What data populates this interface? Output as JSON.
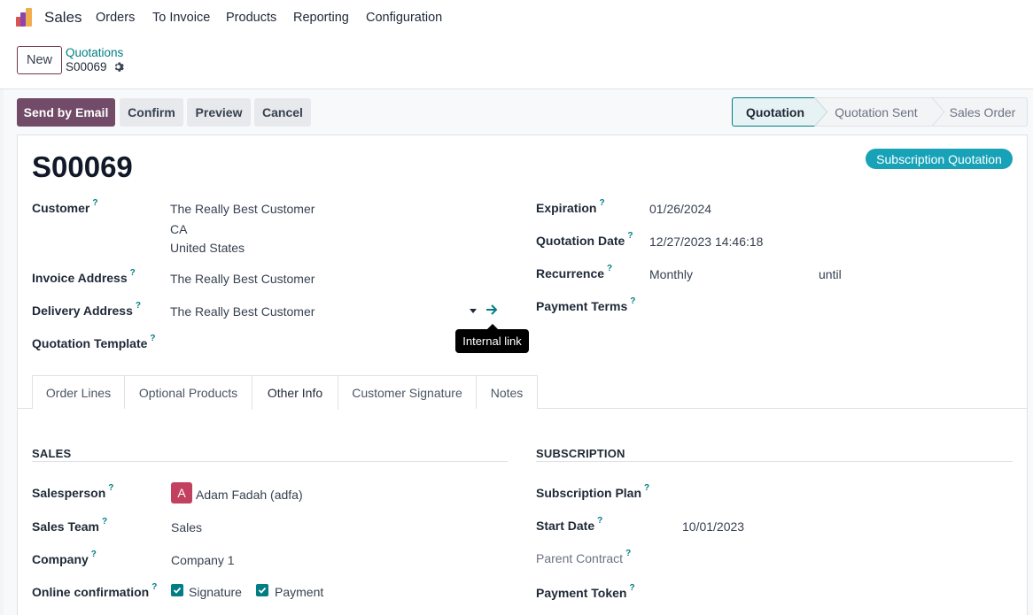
{
  "nav": {
    "app_name": "Sales",
    "menu": [
      "Orders",
      "To Invoice",
      "Products",
      "Reporting",
      "Configuration"
    ]
  },
  "control": {
    "new_label": "New",
    "breadcrumb_parent": "Quotations",
    "breadcrumb_current": "S00069"
  },
  "actions": {
    "send_email": "Send by Email",
    "confirm": "Confirm",
    "preview": "Preview",
    "cancel": "Cancel"
  },
  "statusbar": {
    "steps": [
      "Quotation",
      "Quotation Sent",
      "Sales Order"
    ],
    "active": "Quotation"
  },
  "record": {
    "ribbon": "Subscription Quotation",
    "name": "S00069"
  },
  "fields_left": {
    "customer_label": "Customer",
    "customer_line1": "The Really Best Customer",
    "customer_line2": "CA",
    "customer_line3": "United States",
    "invoice_address_label": "Invoice Address",
    "invoice_address": "The Really Best Customer",
    "delivery_address_label": "Delivery Address",
    "delivery_address": "The Really Best Customer",
    "quotation_template_label": "Quotation Template"
  },
  "fields_right": {
    "expiration_label": "Expiration",
    "expiration": "01/26/2024",
    "quotation_date_label": "Quotation Date",
    "quotation_date": "12/27/2023 14:46:18",
    "recurrence_label": "Recurrence",
    "recurrence": "Monthly",
    "until": "until",
    "payment_terms_label": "Payment Terms"
  },
  "tooltip": "Internal link",
  "help_mark": "?",
  "tabs": [
    "Order Lines",
    "Optional Products",
    "Other Info",
    "Customer Signature",
    "Notes"
  ],
  "active_tab": "Other Info",
  "other_info": {
    "sales_title": "SALES",
    "salesperson_label": "Salesperson",
    "salesperson_initial": "A",
    "salesperson": "Adam Fadah (adfa)",
    "sales_team_label": "Sales Team",
    "sales_team": "Sales",
    "company_label": "Company",
    "company": "Company 1",
    "online_confirmation_label": "Online confirmation",
    "signature_label": "Signature",
    "payment_label": "Payment",
    "subscription_title": "SUBSCRIPTION",
    "subscription_plan_label": "Subscription Plan",
    "start_date_label": "Start Date",
    "start_date": "10/01/2023",
    "parent_contract_label": "Parent Contract",
    "payment_token_label": "Payment Token"
  },
  "colors": {
    "primary": "#714b67",
    "accent": "#017e84",
    "ribbon": "#17a2b8"
  }
}
